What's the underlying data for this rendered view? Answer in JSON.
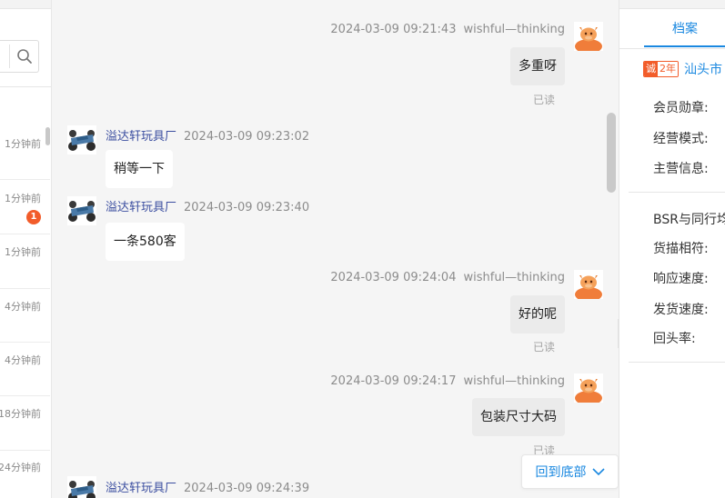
{
  "left": {
    "search_icon": "search-icon",
    "conversations": [
      {
        "time": "1分钟前",
        "badge": ""
      },
      {
        "time": "1分钟前",
        "badge": "1"
      },
      {
        "time": "1分钟前",
        "badge": ""
      },
      {
        "time": "4分钟前",
        "badge": ""
      },
      {
        "time": "4分钟前",
        "badge": ""
      },
      {
        "time": "18分钟前",
        "badge": ""
      },
      {
        "time": "24分钟前",
        "badge": ""
      }
    ]
  },
  "chat": {
    "messages": [
      {
        "direction": "out",
        "timestamp": "2024-03-09 09:21:43",
        "sender": "wishful—thinking",
        "text": "多重呀",
        "status": "已读"
      },
      {
        "direction": "in",
        "timestamp": "2024-03-09 09:23:02",
        "sender": "溢达轩玩具厂",
        "text": "稍等一下"
      },
      {
        "direction": "in",
        "timestamp": "2024-03-09 09:23:40",
        "sender": "溢达轩玩具厂",
        "text": "一条580客"
      },
      {
        "direction": "out",
        "timestamp": "2024-03-09 09:24:04",
        "sender": "wishful—thinking",
        "text": "好的呢",
        "status": "已读"
      },
      {
        "direction": "out",
        "timestamp": "2024-03-09 09:24:17",
        "sender": "wishful—thinking",
        "text": "包装尺寸大码",
        "status": "已读"
      },
      {
        "direction": "in",
        "timestamp": "2024-03-09 09:24:39",
        "sender": "溢达轩玩具厂",
        "text": ""
      }
    ],
    "back_to_bottom": "回到底部"
  },
  "right": {
    "tab_label": "档案",
    "badge_cheng": "诚",
    "badge_years": "2年",
    "company_name": "汕头市",
    "fields": {
      "medal": "会员勋章:",
      "business_mode": "经营模式:",
      "main_business": "主营信息:",
      "bsr": "BSR与同行均",
      "description_match": "货描相符:",
      "response_speed": "响应速度:",
      "shipping_speed": "发货速度:",
      "repurchase_rate": "回头率:"
    }
  },
  "colors": {
    "accent": "#1a88e0",
    "badge": "#f25c2a",
    "seller_name": "#3b4ea0"
  }
}
